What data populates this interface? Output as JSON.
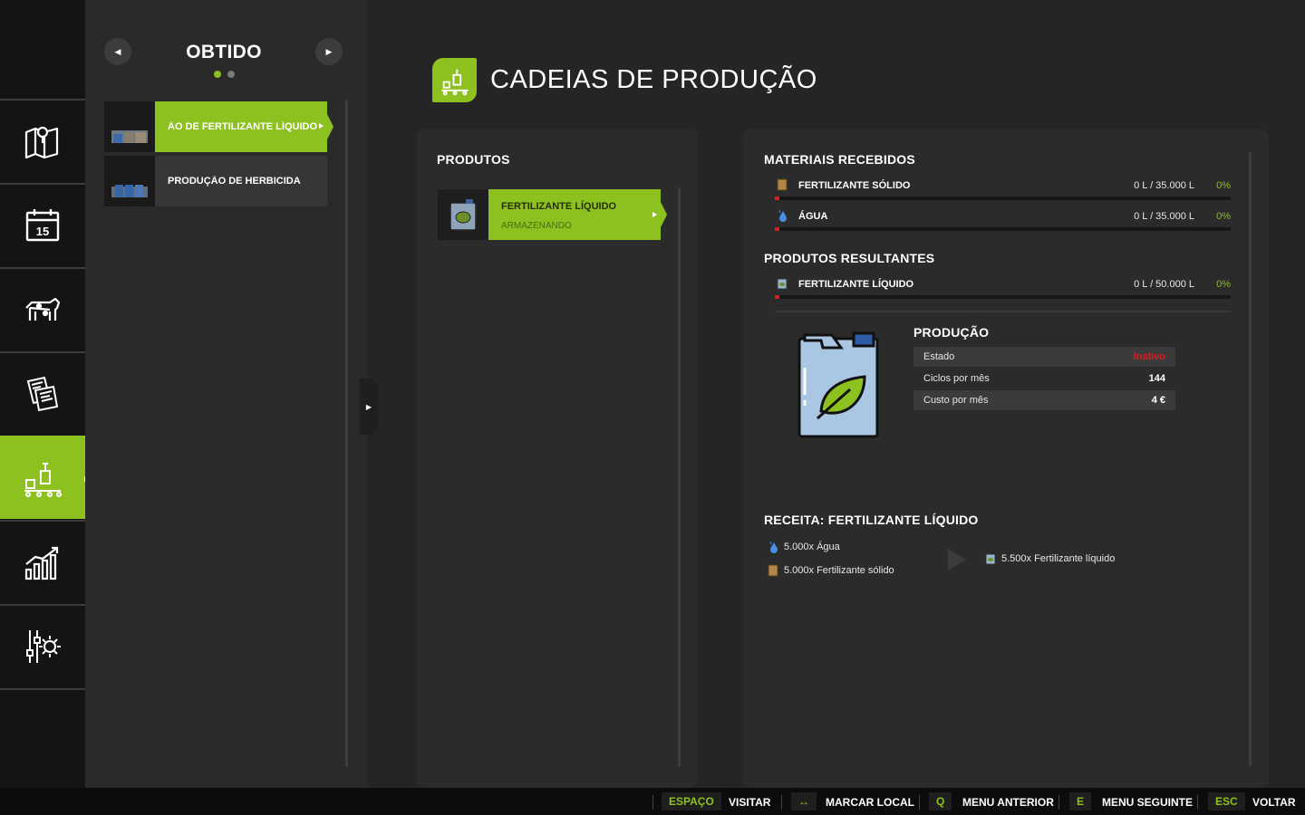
{
  "nav": {
    "items": [
      {
        "icon": "map-icon"
      },
      {
        "icon": "calendar-icon",
        "text": "15"
      },
      {
        "icon": "animals-icon"
      },
      {
        "icon": "contracts-icon"
      },
      {
        "icon": "production-icon",
        "active": true
      },
      {
        "icon": "statistics-icon"
      },
      {
        "icon": "settings-icon"
      }
    ]
  },
  "chains": {
    "title": "OBTIDO",
    "items": [
      {
        "label": "ÃO DE FERTILIZANTE LÍQUIDO",
        "active": true
      },
      {
        "label": "PRODUÇÃO DE HERBICIDA",
        "active": false
      }
    ]
  },
  "main": {
    "title": "CADEIAS DE PRODUÇÃO",
    "products": {
      "title": "PRODUTOS",
      "items": [
        {
          "name": "FERTILIZANTE LÍQUIDO",
          "status": "ARMAZENANDO"
        }
      ]
    },
    "inputs": {
      "title": "MATERIAIS RECEBIDOS",
      "rows": [
        {
          "name": "FERTILIZANTE SÓLIDO",
          "amount": "0 L / 35.000 L",
          "percent": "0%",
          "fill": 0.01
        },
        {
          "name": "ÁGUA",
          "amount": "0 L / 35.000 L",
          "percent": "0%",
          "fill": 0.01
        }
      ]
    },
    "outputs": {
      "title": "PRODUTOS RESULTANTES",
      "rows": [
        {
          "name": "FERTILIZANTE LÍQUIDO",
          "amount": "0 L / 50.000 L",
          "percent": "0%",
          "fill": 0.01
        }
      ]
    },
    "production": {
      "title": "PRODUÇÃO",
      "rows": [
        {
          "key": "Estado",
          "value": "Inativo"
        },
        {
          "key": "Ciclos por mês",
          "value": "144"
        },
        {
          "key": "Custo por mês",
          "value": "4 €"
        }
      ]
    },
    "recipe": {
      "title": "RECEITA: FERTILIZANTE LÍQUIDO",
      "inputs": [
        "5.000x Água",
        "5.000x Fertilizante sólido"
      ],
      "output": "5.500x Fertilizante líquido"
    }
  },
  "footer": {
    "actions": [
      {
        "key": "ESPAÇO",
        "label": "VISITAR"
      },
      {
        "key": "↔",
        "label": "MARCAR LOCAL"
      },
      {
        "key": "Q",
        "label": "MENU ANTERIOR"
      },
      {
        "key": "E",
        "label": "MENU SEGUINTE"
      },
      {
        "key": "ESC",
        "label": "VOLTAR"
      }
    ]
  },
  "colors": {
    "accent": "#8dc11f",
    "danger": "#e01b1b",
    "background": "#252525"
  }
}
